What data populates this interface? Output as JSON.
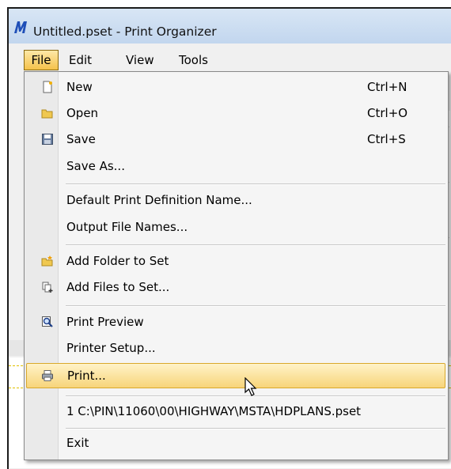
{
  "window": {
    "title": "Untitled.pset - Print Organizer"
  },
  "menubar": {
    "items": [
      {
        "label": "File",
        "active": true
      },
      {
        "label": "Edit"
      },
      {
        "label": "View"
      },
      {
        "label": "Tools"
      }
    ]
  },
  "file_menu": {
    "new": {
      "label": "New",
      "shortcut": "Ctrl+N",
      "icon": "new-document-icon"
    },
    "open": {
      "label": "Open",
      "shortcut": "Ctrl+O",
      "icon": "folder-icon"
    },
    "save": {
      "label": "Save",
      "shortcut": "Ctrl+S",
      "icon": "floppy-disk-icon"
    },
    "save_as": {
      "label": "Save As..."
    },
    "default_print_def": {
      "label": "Default Print Definition Name..."
    },
    "output_file_names": {
      "label": "Output File Names..."
    },
    "add_folder": {
      "label": "Add Folder to Set",
      "icon": "add-folder-icon"
    },
    "add_files": {
      "label": "Add Files to Set...",
      "icon": "add-files-icon"
    },
    "print_preview": {
      "label": "Print Preview",
      "icon": "print-preview-icon"
    },
    "printer_setup": {
      "label": "Printer Setup..."
    },
    "print": {
      "label": "Print...",
      "icon": "printer-icon",
      "highlighted": true
    },
    "recent_1": {
      "label": "1 C:\\PIN\\11060\\00\\HIGHWAY\\MSTA\\HDPLANS.pset"
    },
    "exit": {
      "label": "Exit"
    }
  },
  "colors": {
    "highlight": "#f7d47a",
    "titlebar": "#c2d6ee",
    "menu_bg": "#f5f5f5"
  }
}
